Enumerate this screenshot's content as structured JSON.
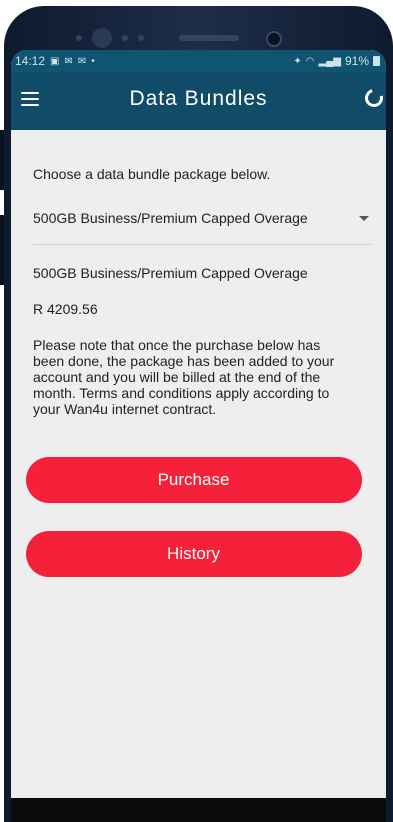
{
  "status_bar": {
    "time": "14:12",
    "notification_icons": [
      "image-icon",
      "mail-icon",
      "mail-icon",
      "dot-icon"
    ],
    "battery_percent": "91%"
  },
  "app_bar": {
    "title": "Data Bundles",
    "menu_icon": "hamburger-menu-icon",
    "refresh_icon": "refresh-icon",
    "background_color": "#104c68"
  },
  "content": {
    "intro": "Choose a data bundle package below.",
    "selected_package": "500GB Business/Premium Capped Overage",
    "package_name": "500GB Business/Premium Capped Overage",
    "package_price": "R 4209.56",
    "notice": "Please note that once the purchase below has been done, the package has been added to your account and you will be billed at the end of the month. Terms and conditions apply according to your Wan4u internet contract."
  },
  "buttons": {
    "purchase_label": "Purchase",
    "history_label": "History",
    "color": "#f5213b"
  }
}
